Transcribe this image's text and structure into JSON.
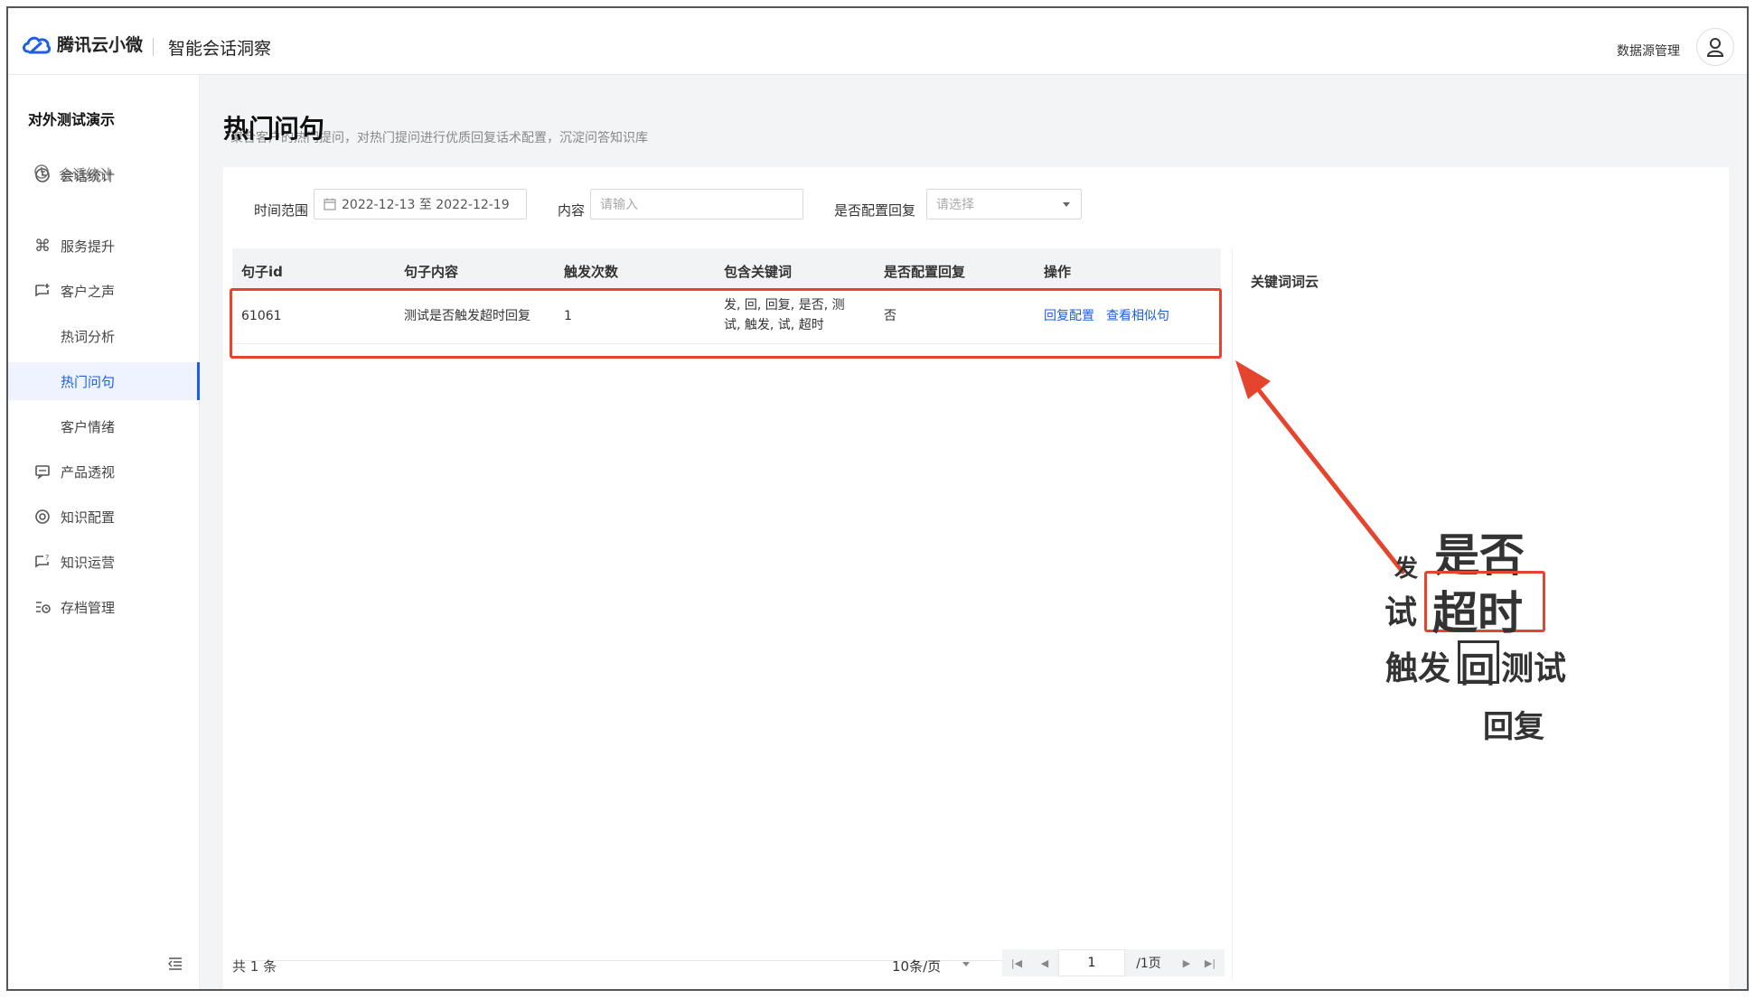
{
  "header": {
    "brand": "腾讯云小微",
    "product": "智能会话洞察",
    "data_source_manage": "数据源管理",
    "avatar_icon": "user-icon"
  },
  "sidebar": {
    "org": "对外测试演示",
    "ghost_label": "会话统计",
    "items": [
      {
        "label": "会话统计",
        "icon": "clock-icon"
      },
      {
        "label": "服务提升",
        "icon": "command-icon"
      },
      {
        "label": "客户之声",
        "icon": "chat-plus-icon"
      },
      {
        "label": "热词分析",
        "icon": ""
      },
      {
        "label": "热门问句",
        "icon": ""
      },
      {
        "label": "客户情绪",
        "icon": ""
      },
      {
        "label": "产品透视",
        "icon": "message-icon"
      },
      {
        "label": "知识配置",
        "icon": "settings-icon"
      },
      {
        "label": "知识运营",
        "icon": "chat-question-icon"
      },
      {
        "label": "存档管理",
        "icon": "archive-icon"
      }
    ],
    "active": "热门问句",
    "collapse_icon": "collapse-menu-icon"
  },
  "page": {
    "title": "热门问句",
    "description": "聚合客户的热门提问，对热门提问进行优质回复话术配置，沉淀问答知识库"
  },
  "filters": {
    "time_label": "时间范围",
    "time_value": "2022-12-13 至 2022-12-19",
    "content_label": "内容",
    "content_placeholder": "请输入",
    "reply_label": "是否配置回复",
    "reply_placeholder": "请选择"
  },
  "table": {
    "columns": [
      "句子id",
      "句子内容",
      "触发次数",
      "包含关键词",
      "是否配置回复",
      "操作"
    ],
    "rows": [
      {
        "id": "61061",
        "content": "测试是否触发超时回复",
        "count": "1",
        "keywords_line1": "发, 回, 回复, 是否, 测",
        "keywords_line2": "试, 触发, 试, 超时",
        "configured": "否",
        "action1": "回复配置",
        "action2": "查看相似句"
      }
    ]
  },
  "pagination": {
    "total": "共 1 条",
    "page_size": "10条/页",
    "current": "1",
    "pages": "/1页"
  },
  "keyword_cloud": {
    "title": "关键词词云",
    "words": [
      "是否",
      "发",
      "试",
      "超时",
      "触发",
      "回",
      "测试",
      "回复"
    ]
  },
  "colors": {
    "accent": "#1d5fe0",
    "highlight": "#e5452e"
  }
}
